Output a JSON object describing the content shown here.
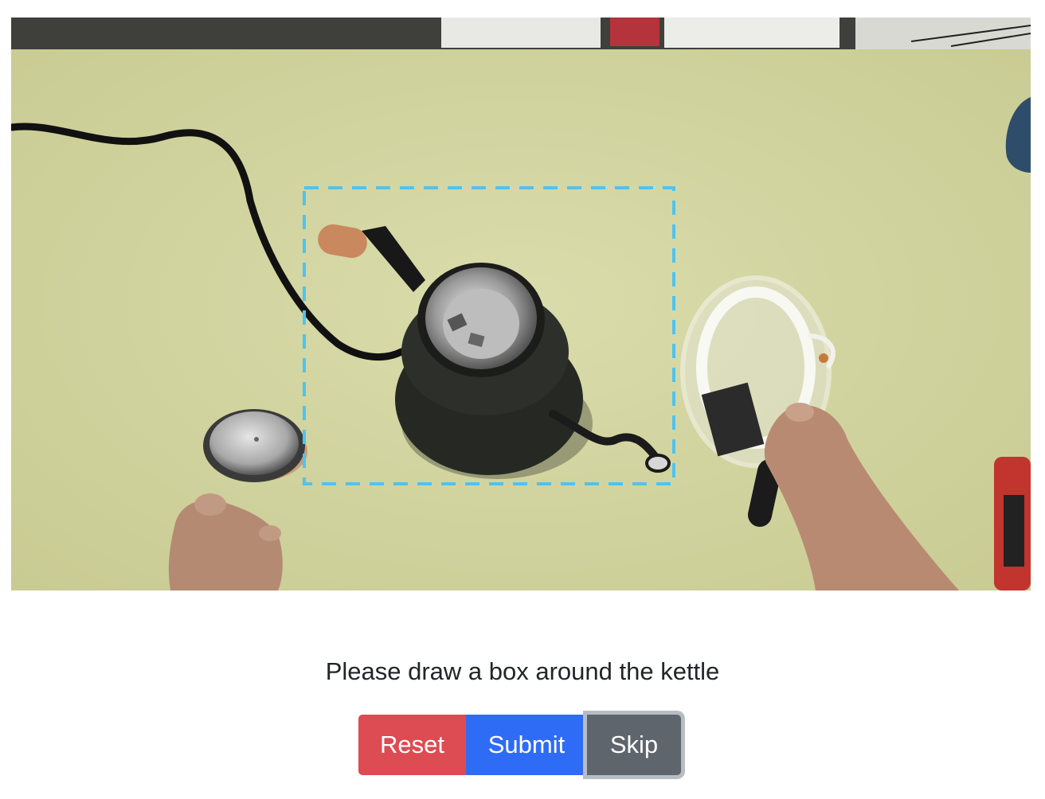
{
  "task": {
    "prompt": "Please draw a box around the kettle"
  },
  "scene": {
    "description_icons": [
      "kettle",
      "kettle-lid",
      "measuring-cup",
      "power-cord",
      "hand",
      "thermometer"
    ],
    "selection_box_color": "#4ec3f0"
  },
  "buttons": {
    "reset_label": "Reset",
    "submit_label": "Submit",
    "skip_label": "Skip"
  },
  "colors": {
    "reset": "#dc4c52",
    "submit": "#2f6cf5",
    "skip": "#5f656c",
    "table": "#d4d7a4"
  }
}
